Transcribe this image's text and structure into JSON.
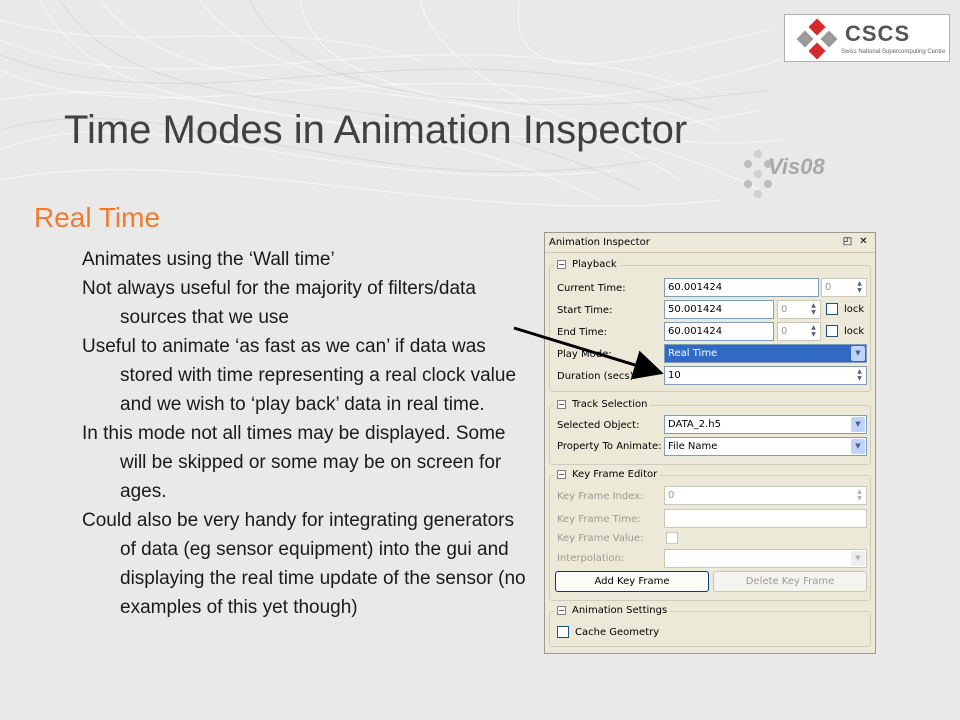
{
  "slide": {
    "title": "Time Modes in Animation Inspector",
    "section_heading": "Real Time",
    "bullets": [
      "Animates using the ‘Wall time’",
      "Not always useful for the majority of filters/data sources that we use",
      "Useful to animate ‘as fast as we can’ if data was stored with time representing a real clock value and we wish to ‘play back’ data in real time.",
      "In this mode not all times may be displayed. Some will be skipped or some may be on screen for ages.",
      "Could also be very handy for integrating generators of data (eg sensor equipment) into the gui and displaying the real time update of the sensor (no examples of this yet though)"
    ],
    "logos": {
      "cscs_word": "CSCS",
      "cscs_sub": "Swiss National Supercomputing Centre",
      "vis_word": "Vis08"
    },
    "colors": {
      "heading": "#ef7b2e",
      "title": "#404040",
      "arrow": "#000000"
    }
  },
  "panel": {
    "title": "Animation Inspector",
    "float_icon": "◰",
    "close_icon": "✕",
    "playback": {
      "title": "Playback",
      "current_time_label": "Current Time:",
      "current_time_value": "60.001424",
      "current_time_index": "0",
      "start_time_label": "Start Time:",
      "start_time_value": "50.001424",
      "start_time_index": "0",
      "start_lock_label": "lock",
      "end_time_label": "End Time:",
      "end_time_value": "60.001424",
      "end_time_index": "0",
      "end_lock_label": "lock",
      "play_mode_label": "Play Mode:",
      "play_mode_value": "Real Time",
      "duration_label": "Duration (secs):",
      "duration_value": "10"
    },
    "track": {
      "title": "Track Selection",
      "selected_object_label": "Selected Object:",
      "selected_object_value": "DATA_2.h5",
      "property_label": "Property To Animate:",
      "property_value": "File Name"
    },
    "keyframe": {
      "title": "Key Frame Editor",
      "index_label": "Key Frame Index:",
      "index_value": "0",
      "time_label": "Key Frame Time:",
      "time_value": "",
      "value_label": "Key Frame Value:",
      "interp_label": "Interpolation:",
      "interp_value": "",
      "add_button": "Add Key Frame",
      "delete_button": "Delete Key Frame"
    },
    "settings": {
      "title": "Animation Settings",
      "cache_label": "Cache Geometry"
    }
  }
}
